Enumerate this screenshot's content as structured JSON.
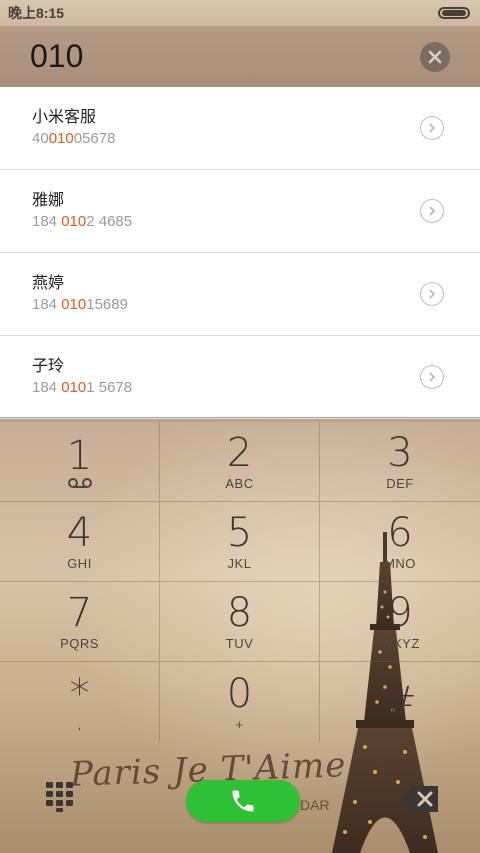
{
  "status_bar": {
    "time": "晚上8:15"
  },
  "dialer": {
    "number": "010"
  },
  "results": [
    {
      "name": "小米客服",
      "number_pre": "40",
      "number_match": "010",
      "number_post": "05678"
    },
    {
      "name": "雅娜",
      "number_pre": "184 ",
      "number_match": "010",
      "number_post": "2 4685"
    },
    {
      "name": "燕婷",
      "number_pre": "184 ",
      "number_match": "010",
      "number_post": "15689"
    },
    {
      "name": "子玲",
      "number_pre": "184 ",
      "number_match": "010",
      "number_post": "1 5678"
    }
  ],
  "keypad": [
    {
      "digit": "1",
      "letters": ""
    },
    {
      "digit": "2",
      "letters": "ABC"
    },
    {
      "digit": "3",
      "letters": "DEF"
    },
    {
      "digit": "4",
      "letters": "GHI"
    },
    {
      "digit": "5",
      "letters": "JKL"
    },
    {
      "digit": "6",
      "letters": "MNO"
    },
    {
      "digit": "7",
      "letters": "PQRS"
    },
    {
      "digit": "8",
      "letters": "TUV"
    },
    {
      "digit": "9",
      "letters": "WXYZ"
    },
    {
      "digit": "*",
      "letters": ","
    },
    {
      "digit": "0",
      "letters": "+"
    },
    {
      "digit": "#",
      "letters": ""
    }
  ],
  "wallpaper": {
    "script": "Paris Je T'Aime",
    "sub": "DAR"
  },
  "colors": {
    "highlight": "#e45a1d",
    "call": "#2ec135"
  }
}
